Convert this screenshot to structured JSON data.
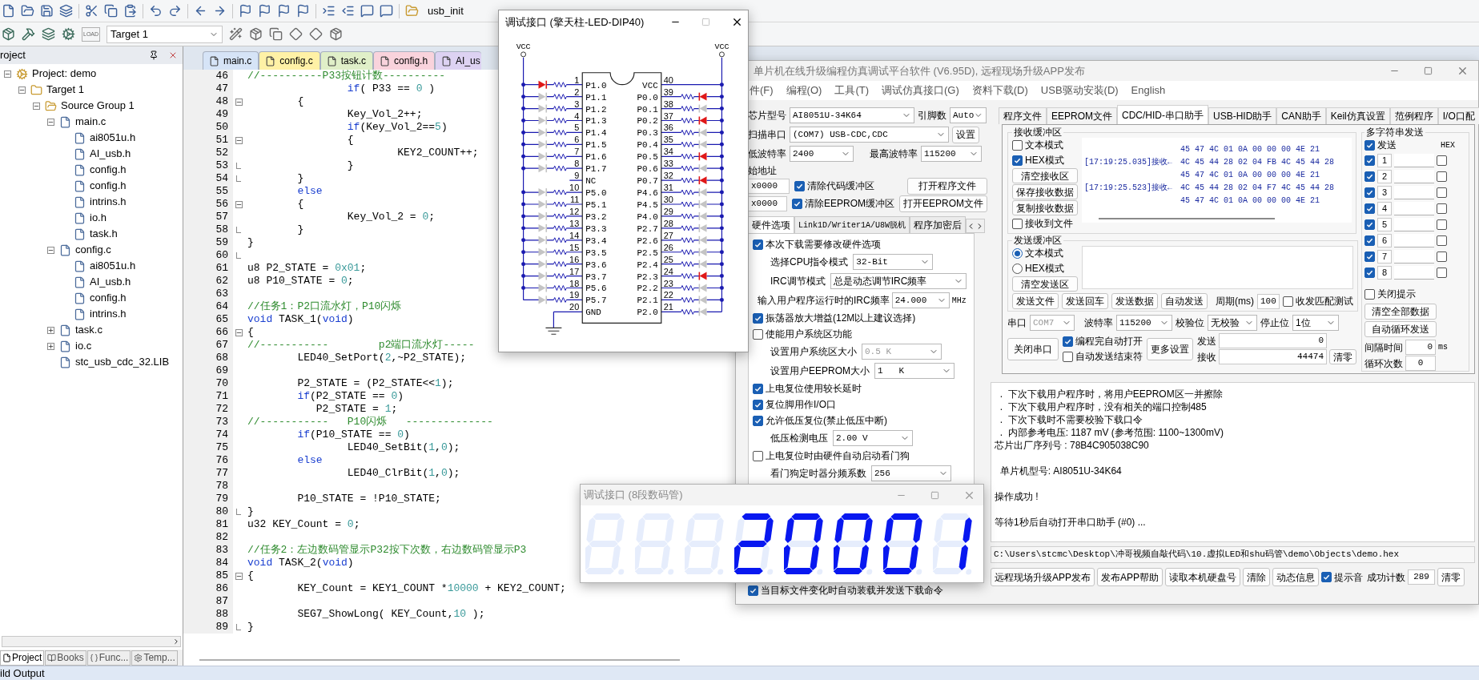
{
  "ide": {
    "toolbar_1": {
      "symbol": "usb_init"
    },
    "toolbar_2": {
      "load_label": "LOAD",
      "target": "Target 1"
    },
    "project_panel": {
      "title": "roject",
      "tree": [
        {
          "label": "Project: demo",
          "kind": "project",
          "expanded": true,
          "children": [
            {
              "label": "Target 1",
              "kind": "target",
              "expanded": true,
              "children": [
                {
                  "label": "Source Group 1",
                  "kind": "folder",
                  "expanded": true,
                  "children": [
                    {
                      "label": "main.c",
                      "kind": "file",
                      "expanded": true,
                      "children": [
                        {
                          "label": "ai8051u.h",
                          "kind": "file"
                        },
                        {
                          "label": "AI_usb.h",
                          "kind": "file"
                        },
                        {
                          "label": "config.h",
                          "kind": "file"
                        },
                        {
                          "label": "config.h",
                          "kind": "file"
                        },
                        {
                          "label": "intrins.h",
                          "kind": "file"
                        },
                        {
                          "label": "io.h",
                          "kind": "file"
                        },
                        {
                          "label": "task.h",
                          "kind": "file"
                        }
                      ]
                    },
                    {
                      "label": "config.c",
                      "kind": "file",
                      "expanded": true,
                      "children": [
                        {
                          "label": "ai8051u.h",
                          "kind": "file"
                        },
                        {
                          "label": "AI_usb.h",
                          "kind": "file"
                        },
                        {
                          "label": "config.h",
                          "kind": "file"
                        },
                        {
                          "label": "intrins.h",
                          "kind": "file"
                        }
                      ]
                    },
                    {
                      "label": "task.c",
                      "kind": "file",
                      "expanded": false
                    },
                    {
                      "label": "io.c",
                      "kind": "file",
                      "expanded": false
                    },
                    {
                      "label": "stc_usb_cdc_32.LIB",
                      "kind": "file"
                    }
                  ]
                }
              ]
            }
          ]
        }
      ],
      "tabs": [
        {
          "label": "Project",
          "selected": true
        },
        {
          "label": "Books",
          "selected": false
        },
        {
          "label": "Func...",
          "selected": false
        },
        {
          "label": "Temp...",
          "selected": false
        }
      ]
    },
    "editor": {
      "tabs": [
        {
          "label": "main.c",
          "color": "#d6e4f7"
        },
        {
          "label": "config.c",
          "color": "#fff1a6"
        },
        {
          "label": "task.c",
          "color": "#e0efc8"
        },
        {
          "label": "config.h",
          "color": "#f9d3dc"
        },
        {
          "label": "AI_us",
          "color": "#ddd2f2"
        }
      ],
      "lines": [
        {
          "number": "46",
          "kind": "line",
          "segments": [
            {
              "kind": "comment",
              "text": "//----------P33按钮计数----------"
            }
          ]
        },
        {
          "number": "47",
          "kind": "line",
          "segments": [
            {
              "kind": "keyword",
              "text": "                if"
            },
            {
              "kind": "code",
              "text": "( P33 == "
            },
            {
              "kind": "number",
              "text": "0"
            },
            {
              "kind": "code",
              "text": " )"
            }
          ]
        },
        {
          "number": "48",
          "kind": "fold_start",
          "segments": [
            {
              "kind": "code",
              "text": "        {"
            }
          ]
        },
        {
          "number": "49",
          "kind": "line",
          "segments": [
            {
              "kind": "code",
              "text": "                Key_Vol_2++;"
            }
          ]
        },
        {
          "number": "50",
          "kind": "line",
          "segments": [
            {
              "kind": "keyword",
              "text": "                if"
            },
            {
              "kind": "code",
              "text": "(Key_Vol_2=="
            },
            {
              "kind": "number",
              "text": "5"
            },
            {
              "kind": "code",
              "text": ")"
            }
          ]
        },
        {
          "number": "51",
          "kind": "fold_start",
          "segments": [
            {
              "kind": "code",
              "text": "                {"
            }
          ]
        },
        {
          "number": "52",
          "kind": "line",
          "segments": [
            {
              "kind": "code",
              "text": "                        KEY2_COUNT++;"
            }
          ]
        },
        {
          "number": "53",
          "kind": "fold_end",
          "segments": [
            {
              "kind": "code",
              "text": "                }"
            }
          ]
        },
        {
          "number": "54",
          "kind": "fold_end",
          "segments": [
            {
              "kind": "code",
              "text": "        }"
            }
          ]
        },
        {
          "number": "55",
          "kind": "line",
          "segments": [
            {
              "kind": "keyword",
              "text": "        else"
            }
          ]
        },
        {
          "number": "56",
          "kind": "fold_start",
          "segments": [
            {
              "kind": "code",
              "text": "        {"
            }
          ]
        },
        {
          "number": "57",
          "kind": "line",
          "segments": [
            {
              "kind": "code",
              "text": "                Key_Vol_2 = "
            },
            {
              "kind": "number",
              "text": "0"
            },
            {
              "kind": "code",
              "text": ";"
            }
          ]
        },
        {
          "number": "58",
          "kind": "fold_end",
          "segments": [
            {
              "kind": "code",
              "text": "        }"
            }
          ]
        },
        {
          "number": "59",
          "kind": "line",
          "segments": [
            {
              "kind": "code",
              "text": "}"
            }
          ]
        },
        {
          "number": "60",
          "kind": "fold_end"
        },
        {
          "number": "61",
          "kind": "line",
          "segments": [
            {
              "kind": "code",
              "text": "u8 P2_STATE = "
            },
            {
              "kind": "number",
              "text": "0x01"
            },
            {
              "kind": "code",
              "text": ";"
            }
          ]
        },
        {
          "number": "62",
          "kind": "line",
          "segments": [
            {
              "kind": "code",
              "text": "u8 P10_STATE = "
            },
            {
              "kind": "number",
              "text": "0"
            },
            {
              "kind": "code",
              "text": ";"
            }
          ]
        },
        {
          "number": "63",
          "kind": "line"
        },
        {
          "number": "64",
          "kind": "line",
          "segments": [
            {
              "kind": "comment",
              "text": "//任务1：P2口流水灯，P10闪烁"
            }
          ]
        },
        {
          "number": "65",
          "kind": "line",
          "segments": [
            {
              "kind": "keyword",
              "text": "void"
            },
            {
              "kind": "code",
              "text": " TASK_1("
            },
            {
              "kind": "keyword",
              "text": "void"
            },
            {
              "kind": "code",
              "text": ")"
            }
          ]
        },
        {
          "number": "66",
          "kind": "fold_start",
          "segments": [
            {
              "kind": "code",
              "text": "{"
            }
          ]
        },
        {
          "number": "67",
          "kind": "line",
          "segments": [
            {
              "kind": "comment",
              "text": "//-----------        p2端口流水灯-----"
            }
          ]
        },
        {
          "number": "68",
          "kind": "line",
          "segments": [
            {
              "kind": "code",
              "text": "        LED40_SetPort("
            },
            {
              "kind": "number",
              "text": "2"
            },
            {
              "kind": "code",
              "text": ",~P2_STATE);"
            }
          ]
        },
        {
          "number": "69",
          "kind": "line"
        },
        {
          "number": "70",
          "kind": "line",
          "segments": [
            {
              "kind": "code",
              "text": "        P2_STATE = (P2_STATE<<"
            },
            {
              "kind": "number",
              "text": "1"
            },
            {
              "kind": "code",
              "text": ");"
            }
          ]
        },
        {
          "number": "71",
          "kind": "line",
          "segments": [
            {
              "kind": "keyword",
              "text": "        if"
            },
            {
              "kind": "code",
              "text": "(P2_STATE == "
            },
            {
              "kind": "number",
              "text": "0"
            },
            {
              "kind": "code",
              "text": ")"
            }
          ]
        },
        {
          "number": "72",
          "kind": "line",
          "segments": [
            {
              "kind": "code",
              "text": "           P2_STATE = "
            },
            {
              "kind": "number",
              "text": "1"
            },
            {
              "kind": "code",
              "text": ";"
            }
          ]
        },
        {
          "number": "73",
          "kind": "line",
          "segments": [
            {
              "kind": "comment",
              "text": "//-----------   P10闪烁   --------------"
            }
          ]
        },
        {
          "number": "74",
          "kind": "line",
          "segments": [
            {
              "kind": "keyword",
              "text": "        if"
            },
            {
              "kind": "code",
              "text": "(P10_STATE == "
            },
            {
              "kind": "number",
              "text": "0"
            },
            {
              "kind": "code",
              "text": ")"
            }
          ]
        },
        {
          "number": "75",
          "kind": "line",
          "segments": [
            {
              "kind": "code",
              "text": "                LED40_SetBit("
            },
            {
              "kind": "number",
              "text": "1"
            },
            {
              "kind": "code",
              "text": ","
            },
            {
              "kind": "number",
              "text": "0"
            },
            {
              "kind": "code",
              "text": ");"
            }
          ]
        },
        {
          "number": "76",
          "kind": "line",
          "segments": [
            {
              "kind": "keyword",
              "text": "        else"
            }
          ]
        },
        {
          "number": "77",
          "kind": "line",
          "segments": [
            {
              "kind": "code",
              "text": "                LED40_ClrBit("
            },
            {
              "kind": "number",
              "text": "1"
            },
            {
              "kind": "code",
              "text": ","
            },
            {
              "kind": "number",
              "text": "0"
            },
            {
              "kind": "code",
              "text": ");"
            }
          ]
        },
        {
          "number": "78",
          "kind": "line"
        },
        {
          "number": "79",
          "kind": "line",
          "segments": [
            {
              "kind": "code",
              "text": "        P10_STATE = !P10_STATE;"
            }
          ]
        },
        {
          "number": "80",
          "kind": "fold_end",
          "segments": [
            {
              "kind": "code",
              "text": "}"
            }
          ]
        },
        {
          "number": "81",
          "kind": "line",
          "segments": [
            {
              "kind": "code",
              "text": "u32 KEY_Count = "
            },
            {
              "kind": "number",
              "text": "0"
            },
            {
              "kind": "code",
              "text": ";"
            }
          ]
        },
        {
          "number": "82",
          "kind": "line"
        },
        {
          "number": "83",
          "kind": "line",
          "segments": [
            {
              "kind": "comment",
              "text": "//任务2：左边数码管显示P32按下次数，右边数码管显示P3"
            }
          ]
        },
        {
          "number": "84",
          "kind": "line",
          "segments": [
            {
              "kind": "keyword",
              "text": "void"
            },
            {
              "kind": "code",
              "text": " TASK_2("
            },
            {
              "kind": "keyword",
              "text": "void"
            },
            {
              "kind": "code",
              "text": ")"
            }
          ]
        },
        {
          "number": "85",
          "kind": "fold_start",
          "segments": [
            {
              "kind": "code",
              "text": "{"
            }
          ]
        },
        {
          "number": "86",
          "kind": "line",
          "segments": [
            {
              "kind": "code",
              "text": "        KEY_Count = KEY1_COUNT *"
            },
            {
              "kind": "number",
              "text": "10000"
            },
            {
              "kind": "code",
              "text": " + KEY2_COUNT;"
            }
          ]
        },
        {
          "number": "87",
          "kind": "line"
        },
        {
          "number": "88",
          "kind": "line",
          "segments": [
            {
              "kind": "code",
              "text": "        SEG7_ShowLong( KEY_Count,"
            },
            {
              "kind": "number",
              "text": "10"
            },
            {
              "kind": "code",
              "text": " );"
            }
          ]
        },
        {
          "number": "89",
          "kind": "fold_end",
          "segments": [
            {
              "kind": "code",
              "text": "}"
            }
          ]
        }
      ]
    },
    "output_bar": "ild Output"
  },
  "dip_window": {
    "title": "调试接口 (擎天柱-LED-DIP40)",
    "vcc_labels": [
      "VCC",
      "VCC"
    ],
    "left_pins": [
      {
        "number": "1",
        "label": "P1.0",
        "kind": "led",
        "lit": true
      },
      {
        "number": "2",
        "label": "P1.1",
        "kind": "led",
        "lit": false
      },
      {
        "number": "3",
        "label": "P1.2",
        "kind": "led",
        "lit": false
      },
      {
        "number": "4",
        "label": "P1.3",
        "kind": "led",
        "lit": false
      },
      {
        "number": "5",
        "label": "P1.4",
        "kind": "led",
        "lit": false
      },
      {
        "number": "6",
        "label": "P1.5",
        "kind": "led",
        "lit": false
      },
      {
        "number": "7",
        "label": "P1.6",
        "kind": "led",
        "lit": false
      },
      {
        "number": "8",
        "label": "P1.7",
        "kind": "led",
        "lit": false
      },
      {
        "number": "9",
        "label": "NC",
        "kind": "nc"
      },
      {
        "number": "10",
        "label": "P5.0",
        "kind": "led",
        "lit": false
      },
      {
        "number": "11",
        "label": "P5.1",
        "kind": "led",
        "lit": false
      },
      {
        "number": "12",
        "label": "P3.2",
        "kind": "led",
        "lit": false
      },
      {
        "number": "13",
        "label": "P3.3",
        "kind": "led",
        "lit": false
      },
      {
        "number": "14",
        "label": "P3.4",
        "kind": "led",
        "lit": false
      },
      {
        "number": "15",
        "label": "P3.5",
        "kind": "led",
        "lit": false
      },
      {
        "number": "16",
        "label": "P3.6",
        "kind": "led",
        "lit": false
      },
      {
        "number": "17",
        "label": "P3.7",
        "kind": "led",
        "lit": false
      },
      {
        "number": "18",
        "label": "P5.6",
        "kind": "led",
        "lit": false
      },
      {
        "number": "19",
        "label": "P5.7",
        "kind": "led",
        "lit": false
      },
      {
        "number": "20",
        "label": "GND",
        "kind": "ground"
      }
    ],
    "right_pins": [
      {
        "number": "40",
        "label": "VCC",
        "kind": "vcc"
      },
      {
        "number": "39",
        "label": "P0.0",
        "kind": "led",
        "lit": true
      },
      {
        "number": "38",
        "label": "P0.1",
        "kind": "led",
        "lit": false
      },
      {
        "number": "37",
        "label": "P0.2",
        "kind": "led",
        "lit": true
      },
      {
        "number": "36",
        "label": "P0.3",
        "kind": "led",
        "lit": false
      },
      {
        "number": "35",
        "label": "P0.4",
        "kind": "led",
        "lit": false
      },
      {
        "number": "34",
        "label": "P0.5",
        "kind": "led",
        "lit": true
      },
      {
        "number": "33",
        "label": "P0.6",
        "kind": "led",
        "lit": false
      },
      {
        "number": "32",
        "label": "P0.7",
        "kind": "led",
        "lit": true
      },
      {
        "number": "31",
        "label": "P4.6",
        "kind": "led",
        "lit": false
      },
      {
        "number": "30",
        "label": "P4.5",
        "kind": "led",
        "lit": false
      },
      {
        "number": "29",
        "label": "P4.0",
        "kind": "led",
        "lit": false
      },
      {
        "number": "28",
        "label": "P2.7",
        "kind": "led",
        "lit": false
      },
      {
        "number": "27",
        "label": "P2.6",
        "kind": "led",
        "lit": false
      },
      {
        "number": "26",
        "label": "P2.5",
        "kind": "led",
        "lit": false
      },
      {
        "number": "25",
        "label": "P2.4",
        "kind": "led",
        "lit": false
      },
      {
        "number": "24",
        "label": "P2.3",
        "kind": "led",
        "lit": true
      },
      {
        "number": "23",
        "label": "P2.2",
        "kind": "led",
        "lit": false
      },
      {
        "number": "22",
        "label": "P2.1",
        "kind": "led",
        "lit": false
      },
      {
        "number": "21",
        "label": "P2.0",
        "kind": "led",
        "lit": false
      }
    ]
  },
  "programmer": {
    "title": "单片机在线升级编程仿真调试平台软件 (V6.95D), 远程现场升级APP发布",
    "menu": [
      "件(F)",
      "编程(O)",
      "工具(T)",
      "调试仿真接口(G)",
      "资料下载(D)",
      "USB驱动安装(D)",
      "English"
    ],
    "chip": {
      "label": "芯片型号",
      "value": "AI8051U-34K64",
      "pins_label": "引脚数",
      "pins_value": "Auto"
    },
    "port": {
      "label": "扫描串口",
      "value": "(COM7) USB-CDC,CDC",
      "button": "设置"
    },
    "baud": {
      "min_label": "低波特率",
      "min_value": "2400",
      "max_label": "最高波特率",
      "max_value": "115200"
    },
    "start_address": {
      "label": "始地址",
      "code_value": "x0000",
      "eeprom_value": "x0000"
    },
    "clear_code": {
      "label": "清除代码缓冲区",
      "checked": true
    },
    "clear_eeprom": {
      "label": "清除EEPROM缓冲区",
      "checked": true
    },
    "open_buttons": [
      "打开程序文件",
      "打开EEPROM文件"
    ],
    "left_tabs": [
      {
        "label": "硬件选项",
        "selected": true
      },
      {
        "label": "Link1D/Writer1A/U8W脱机",
        "selected": false
      },
      {
        "label": "程序加密后",
        "selected": false
      }
    ],
    "options": [
      {
        "kind": "check",
        "label": "本次下载需要修改硬件选项",
        "checked": true
      },
      {
        "kind": "select",
        "label": "选择CPU指令模式",
        "value": "32-Bit",
        "disabled": false
      },
      {
        "kind": "select",
        "label": "IRC调节模式",
        "value": "总是动态调节IRC频率",
        "disabled": false
      },
      {
        "kind": "input",
        "label": "输入用户程序运行时的IRC频率",
        "value": "24.000",
        "unit": "MHz"
      },
      {
        "kind": "check",
        "label": "振荡器放大增益(12M以上建议选择)",
        "checked": true
      },
      {
        "kind": "check",
        "label": "使能用户系统区功能",
        "checked": false
      },
      {
        "kind": "select",
        "label": "设置用户系统区大小",
        "value": "0.5 K",
        "disabled": true
      },
      {
        "kind": "select",
        "label": "设置用户EEPROM大小",
        "value": "1   K",
        "disabled": false
      },
      {
        "kind": "check",
        "label": "上电复位使用较长延时",
        "checked": true
      },
      {
        "kind": "check",
        "label": "复位脚用作I/O口",
        "checked": true
      },
      {
        "kind": "check",
        "label": "允许低压复位(禁止低压中断)",
        "checked": true
      },
      {
        "kind": "select",
        "label": "低压检测电压",
        "value": "2.00 V",
        "disabled": false
      },
      {
        "kind": "check",
        "label": "上电复位时由硬件自动启动看门狗",
        "checked": false
      },
      {
        "kind": "select",
        "label": "看门狗定时器分频系数",
        "value": "256",
        "disabled": false
      }
    ],
    "auto_load": {
      "label": "当目标文件变化时自动装载并发送下载命令",
      "checked": true
    },
    "right_tabs": [
      {
        "label": "程序文件",
        "selected": false
      },
      {
        "label": "EEPROM文件",
        "selected": false
      },
      {
        "label": "CDC/HID-串口助手",
        "selected": true
      },
      {
        "label": "USB-HID助手",
        "selected": false
      },
      {
        "label": "CAN助手",
        "selected": false
      },
      {
        "label": "Keil仿真设置",
        "selected": false
      },
      {
        "label": "范例程序",
        "selected": false
      },
      {
        "label": "I/O口配",
        "selected": false
      }
    ],
    "receive": {
      "title": "接收缓冲区",
      "text_mode": {
        "label": "文本模式",
        "checked": false
      },
      "hex_mode": {
        "label": "HEX模式",
        "checked": true
      },
      "buttons": [
        "清空接收区",
        "保存接收数据",
        "复制接收数据"
      ],
      "to_file": {
        "label": "接收到文件",
        "checked": false
      },
      "rows": [
        {
          "data": "45 47 4C 01 0A 00 00 00 4E 21"
        },
        {
          "time": "[17:19:25.035]接收←",
          "data": "4C 45 44 28 02 04 FB 4C 45 44 28"
        },
        {
          "data": "45 47 4C 01 0A 00 00 00 4E 21"
        },
        {
          "time": "[17:19:25.523]接收←",
          "data": "4C 45 44 28 02 04 F7 4C 45 44 28"
        },
        {
          "data": "45 47 4C 01 0A 00 00 00 4E 21"
        }
      ]
    },
    "send": {
      "title": "发送缓冲区",
      "modes": [
        {
          "label": "文本模式",
          "selected": true
        },
        {
          "label": "HEX模式",
          "selected": false
        }
      ],
      "clear_button": "清空发送区",
      "buttons": [
        "发送文件",
        "发送回车",
        "发送数据",
        "自动发送"
      ],
      "period_label": "周期(ms)",
      "period_value": "100",
      "match_test": {
        "label": "收发匹配测试",
        "checked": false
      }
    },
    "serial": {
      "port_label": "串口",
      "port_value": "COM7",
      "baud_label": "波特率",
      "baud_value": "115200",
      "parity_label": "校验位",
      "parity_value": "无校验",
      "stop_label": "停止位",
      "stop_value": "1位"
    },
    "close_port_button": "关闭串口",
    "auto_open": {
      "label": "编程完自动打开",
      "checked": true
    },
    "auto_end": {
      "label": "自动发送结束符",
      "checked": false
    },
    "more_button": "更多设置",
    "counters": {
      "sent_label": "发送",
      "sent_value": "0",
      "received_label": "接收",
      "received_value": "44474",
      "clear_button": "清零"
    },
    "multi": {
      "title": "多字符串发送",
      "send": {
        "label": "发送",
        "checked": true
      },
      "hex_header": "HEX",
      "rows": [
        {
          "number": "1",
          "checked": true,
          "hex": false
        },
        {
          "number": "2",
          "checked": true,
          "hex": false
        },
        {
          "number": "3",
          "checked": true,
          "hex": false
        },
        {
          "number": "4",
          "checked": true,
          "hex": false
        },
        {
          "number": "5",
          "checked": true,
          "hex": false
        },
        {
          "number": "6",
          "checked": true,
          "hex": false
        },
        {
          "number": "7",
          "checked": true,
          "hex": false
        },
        {
          "number": "8",
          "checked": true,
          "hex": false
        }
      ],
      "close_hint": {
        "label": "关闭提示",
        "checked": false
      },
      "clear_all_button": "清空全部数据",
      "loop_button": "自动循环发送",
      "interval_label": "间隔时间",
      "interval_value": "0",
      "interval_unit": "ms",
      "loop_label": "循环次数",
      "loop_value": "0"
    },
    "log": [
      {
        "lines": [
          "  .  下次下载用户程序时，将用户EEPROM区一并擦除",
          "  .  下次下载用户程序时，没有相关的端口控制485",
          "  .  下次下载时不需要校验下载口令",
          "  .  内部参考电压: 1187 mV (参考范围: 1100~1300mV)",
          "芯片出厂序列号 : 78B4C905038C90"
        ]
      },
      {
        "lines": [
          "  单片机型号: AI8051U-34K64"
        ]
      },
      {
        "lines": [
          "操作成功 !"
        ]
      },
      {
        "lines": [
          "等待1秒后自动打开串口助手 (#0) ..."
        ]
      }
    ],
    "path": "C:\\Users\\stcmc\\Desktop\\冲哥视频自敲代码\\10.虚拟LED和shu码管\\demo\\Objects\\demo.hex",
    "bottom_buttons": [
      "远程现场升级APP发布",
      "发布APP帮助",
      "读取本机硬盘号",
      "清除",
      "动态信息"
    ],
    "beep": {
      "label": "提示音",
      "checked": true
    },
    "success": {
      "label": "成功计数",
      "value": "289",
      "clear_button": "清零"
    }
  },
  "segment_window": {
    "title": "调试接口 (8段数码管)",
    "digits": [
      {
        "a": false,
        "b": false,
        "c": false,
        "d": false,
        "e": false,
        "f": false,
        "g": false
      },
      {
        "a": false,
        "b": false,
        "c": false,
        "d": false,
        "e": false,
        "f": false,
        "g": false
      },
      {
        "a": false,
        "b": false,
        "c": false,
        "d": false,
        "e": false,
        "f": false,
        "g": false
      },
      {
        "a": true,
        "b": true,
        "c": false,
        "d": true,
        "e": true,
        "f": false,
        "g": true
      },
      {
        "a": true,
        "b": true,
        "c": true,
        "d": true,
        "e": true,
        "f": true,
        "g": false
      },
      {
        "a": true,
        "b": true,
        "c": true,
        "d": true,
        "e": true,
        "f": true,
        "g": false
      },
      {
        "a": true,
        "b": true,
        "c": true,
        "d": true,
        "e": true,
        "f": true,
        "g": false
      },
      {
        "a": false,
        "b": true,
        "c": true,
        "d": false,
        "e": false,
        "f": false,
        "g": false
      }
    ]
  }
}
